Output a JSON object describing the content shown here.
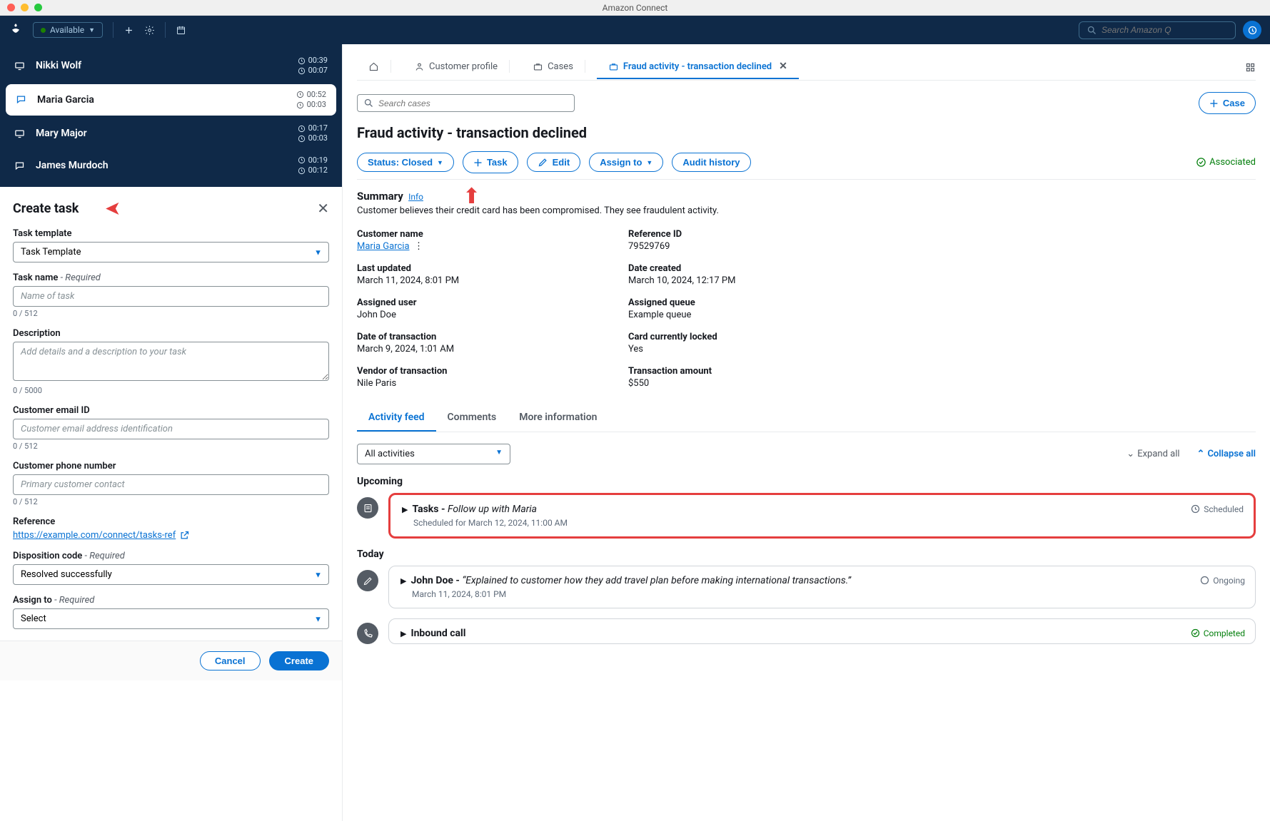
{
  "window": {
    "title": "Amazon Connect"
  },
  "topnav": {
    "status": "Available",
    "search_placeholder": "Search Amazon Q"
  },
  "contacts": [
    {
      "name": "Nikki Wolf",
      "icon": "screen",
      "t1": "00:39",
      "t2": "00:07",
      "active": false
    },
    {
      "name": "Maria Garcia",
      "icon": "chat",
      "t1": "00:52",
      "t2": "00:03",
      "active": true
    },
    {
      "name": "Mary Major",
      "icon": "screen",
      "t1": "00:17",
      "t2": "00:03",
      "active": false
    },
    {
      "name": "James Murdoch",
      "icon": "chat",
      "t1": "00:19",
      "t2": "00:12",
      "active": false
    }
  ],
  "task_panel": {
    "heading": "Create task",
    "template_label": "Task template",
    "template_value": "Task Template",
    "name_label": "Task name",
    "required": "- Required",
    "name_placeholder": "Name of task",
    "name_counter": "0 / 512",
    "desc_label": "Description",
    "desc_placeholder": "Add details and a description to your task",
    "desc_counter": "0 / 5000",
    "email_label": "Customer email ID",
    "email_placeholder": "Customer email address identification",
    "email_counter": "0 / 512",
    "phone_label": "Customer phone number",
    "phone_placeholder": "Primary customer contact",
    "phone_counter": "0 / 512",
    "ref_label": "Reference",
    "ref_link": "https://example.com/connect/tasks-ref",
    "disp_label": "Disposition code",
    "disp_value": "Resolved successfully",
    "assign_label": "Assign to",
    "assign_value": "Select",
    "cancel": "Cancel",
    "create": "Create"
  },
  "tabs": {
    "customer_profile": "Customer profile",
    "cases": "Cases",
    "active": "Fraud activity - transaction declined"
  },
  "case_search": {
    "placeholder": "Search cases",
    "add_case": "Case"
  },
  "case": {
    "title": "Fraud activity - transaction declined",
    "status_btn": "Status: Closed",
    "task_btn": "Task",
    "edit_btn": "Edit",
    "assign_btn": "Assign to",
    "audit_btn": "Audit history",
    "associated": "Associated",
    "summary_h": "Summary",
    "info": "Info",
    "summary": "Customer believes their credit card has been compromised. They see fraudulent activity.",
    "details": {
      "customer_name_l": "Customer name",
      "customer_name_v": "Maria Garcia",
      "reference_l": "Reference ID",
      "reference_v": "79529769",
      "updated_l": "Last updated",
      "updated_v": "March 11, 2024, 8:01 PM",
      "created_l": "Date created",
      "created_v": "March 10, 2024, 12:17 PM",
      "user_l": "Assigned user",
      "user_v": "John Doe",
      "queue_l": "Assigned queue",
      "queue_v": "Example queue",
      "txd_l": "Date of transaction",
      "txd_v": "March 9, 2024, 1:01 AM",
      "locked_l": "Card currently locked",
      "locked_v": "Yes",
      "vendor_l": "Vendor of transaction",
      "vendor_v": "Nile Paris",
      "amount_l": "Transaction amount",
      "amount_v": "$550"
    }
  },
  "subtabs": {
    "feed": "Activity feed",
    "comments": "Comments",
    "more": "More information"
  },
  "feed": {
    "all_activities": "All activities",
    "expand": "Expand all",
    "collapse": "Collapse all",
    "upcoming": "Upcoming",
    "today": "Today",
    "item1_title_pre": "Tasks - ",
    "item1_title_em": "Follow up with Maria",
    "item1_sub": "Scheduled for March 12, 2024, 11:00 AM",
    "item1_status": "Scheduled",
    "item2_title_pre": "John Doe - ",
    "item2_title_em": "“Explained to customer how they add travel plan before making international transactions.”",
    "item2_sub": "March 11, 2024, 8:01 PM",
    "item2_status": "Ongoing",
    "item3_title": "Inbound call",
    "item3_status": "Completed"
  }
}
